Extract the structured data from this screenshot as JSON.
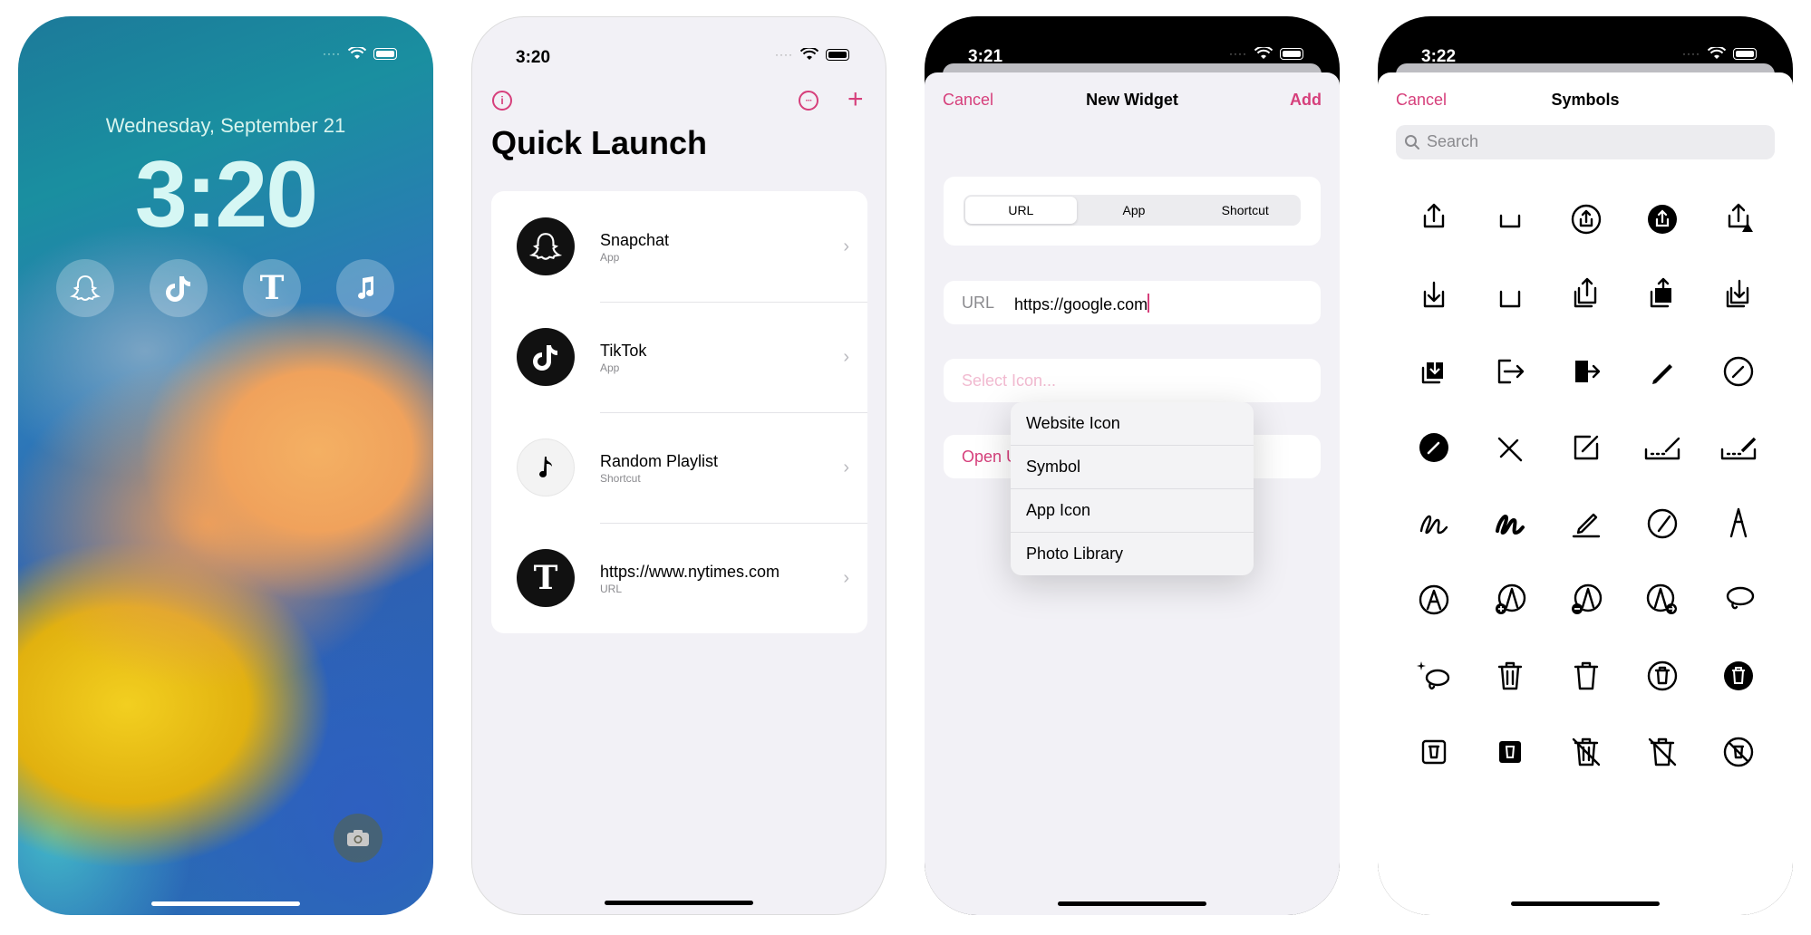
{
  "lock_screen": {
    "date": "Wednesday, September 21",
    "time": "3:20",
    "widgets": [
      "snapchat-icon",
      "tiktok-icon",
      "nytimes-icon",
      "music-note-icon"
    ],
    "camera_icon": "camera-icon"
  },
  "quick_launch": {
    "status_time": "3:20",
    "title": "Quick Launch",
    "accent_color": "#d63f7b",
    "info_icon": "i",
    "more_icon": "···",
    "add_icon": "+",
    "items": [
      {
        "title": "Snapchat",
        "subtitle": "App",
        "icon": "snapchat-icon"
      },
      {
        "title": "TikTok",
        "subtitle": "App",
        "icon": "tiktok-icon"
      },
      {
        "title": "Random Playlist",
        "subtitle": "Shortcut",
        "icon": "music-note-icon"
      },
      {
        "title": "https://www.nytimes.com",
        "subtitle": "URL",
        "icon": "nytimes-icon"
      }
    ],
    "chevron": "›"
  },
  "new_widget": {
    "status_time": "3:21",
    "cancel": "Cancel",
    "title": "New Widget",
    "add": "Add",
    "segments": [
      "URL",
      "App",
      "Shortcut"
    ],
    "selected_segment": "URL",
    "url_label": "URL",
    "url_value": "https://google.com",
    "select_icon_placeholder": "Select Icon...",
    "open_label": "Open U",
    "menu": [
      "Website Icon",
      "Symbol",
      "App Icon",
      "Photo Library"
    ]
  },
  "symbols": {
    "status_time": "3:22",
    "cancel": "Cancel",
    "title": "Symbols",
    "search_placeholder": "Search",
    "icons": [
      "square-and-arrow-up-icon",
      "square-and-arrow-up-fill-icon",
      "square-and-arrow-up-circle-icon",
      "square-and-arrow-up-circle-fill-icon",
      "square-and-arrow-up-trianglebadge-icon",
      "square-and-arrow-down-icon",
      "square-and-arrow-down-fill-icon",
      "square-and-arrow-up-on-square-icon",
      "square-and-arrow-up-on-square-fill-icon",
      "square-and-arrow-down-on-square-icon",
      "square-and-arrow-down-on-square-fill-icon",
      "rectangle-portrait-and-arrow-right-icon",
      "rectangle-portrait-and-arrow-right-fill-icon",
      "pencil-icon",
      "pencil-circle-icon",
      "pencil-circle-fill-icon",
      "pencil-slash-icon",
      "square-and-pencil-icon",
      "rectangle-and-pencil-icon",
      "rectangle-and-pencil-fill-icon",
      "scribble-icon",
      "scribble-variable-icon",
      "pencil-line-icon",
      "pencil-tip-circle-icon",
      "pencil-tip-icon",
      "pencil-tip-crop-circle-icon",
      "pencil-tip-crop-circle-badge-plus-icon",
      "pencil-tip-crop-circle-badge-minus-icon",
      "pencil-tip-crop-circle-badge-arrow-icon",
      "lasso-icon",
      "lasso-sparkles-icon",
      "trash-icon",
      "trash-fill-icon",
      "trash-circle-icon",
      "trash-circle-fill-icon",
      "trash-square-icon",
      "trash-square-fill-icon",
      "trash-slash-icon",
      "trash-slash-fill-icon",
      "trash-slash-circle-icon"
    ]
  }
}
